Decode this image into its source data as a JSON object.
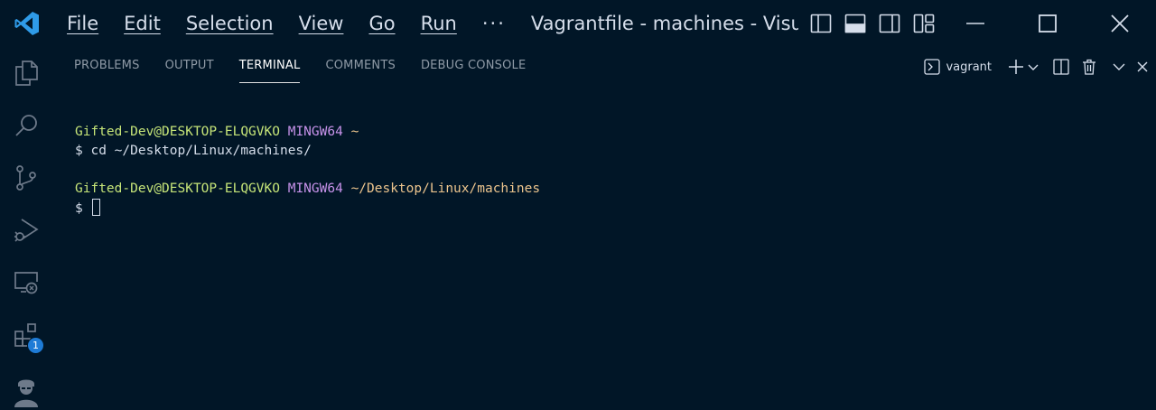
{
  "titlebar": {
    "menu": [
      "File",
      "Edit",
      "Selection",
      "View",
      "Go",
      "Run"
    ],
    "more": "···",
    "title": "Vagrantfile - machines - Visual..."
  },
  "activitybar": {
    "items": [
      "explorer-icon",
      "search-icon",
      "source-control-icon",
      "run-debug-icon",
      "remote-explorer-icon",
      "extensions-icon",
      "account-icon"
    ],
    "extensions_badge": "1"
  },
  "panel": {
    "tabs": [
      "PROBLEMS",
      "OUTPUT",
      "TERMINAL",
      "COMMENTS",
      "DEBUG CONSOLE"
    ],
    "active_tab": "TERMINAL",
    "terminal_name": "vagrant"
  },
  "terminal": {
    "prompt1": {
      "user": "Gifted-Dev@DESKTOP-ELQGVKO",
      "shell": "MINGW64",
      "path": "~"
    },
    "command1": "$ cd ~/Desktop/Linux/machines/",
    "prompt2": {
      "user": "Gifted-Dev@DESKTOP-ELQGVKO",
      "shell": "MINGW64",
      "path": "~/Desktop/Linux/machines"
    },
    "command2": "$ "
  },
  "colors": {
    "background": "#011627",
    "prompt_user": "#c5e478",
    "prompt_shell": "#c792ea",
    "prompt_path": "#ecc48d",
    "badge": "#1e7bd6"
  }
}
